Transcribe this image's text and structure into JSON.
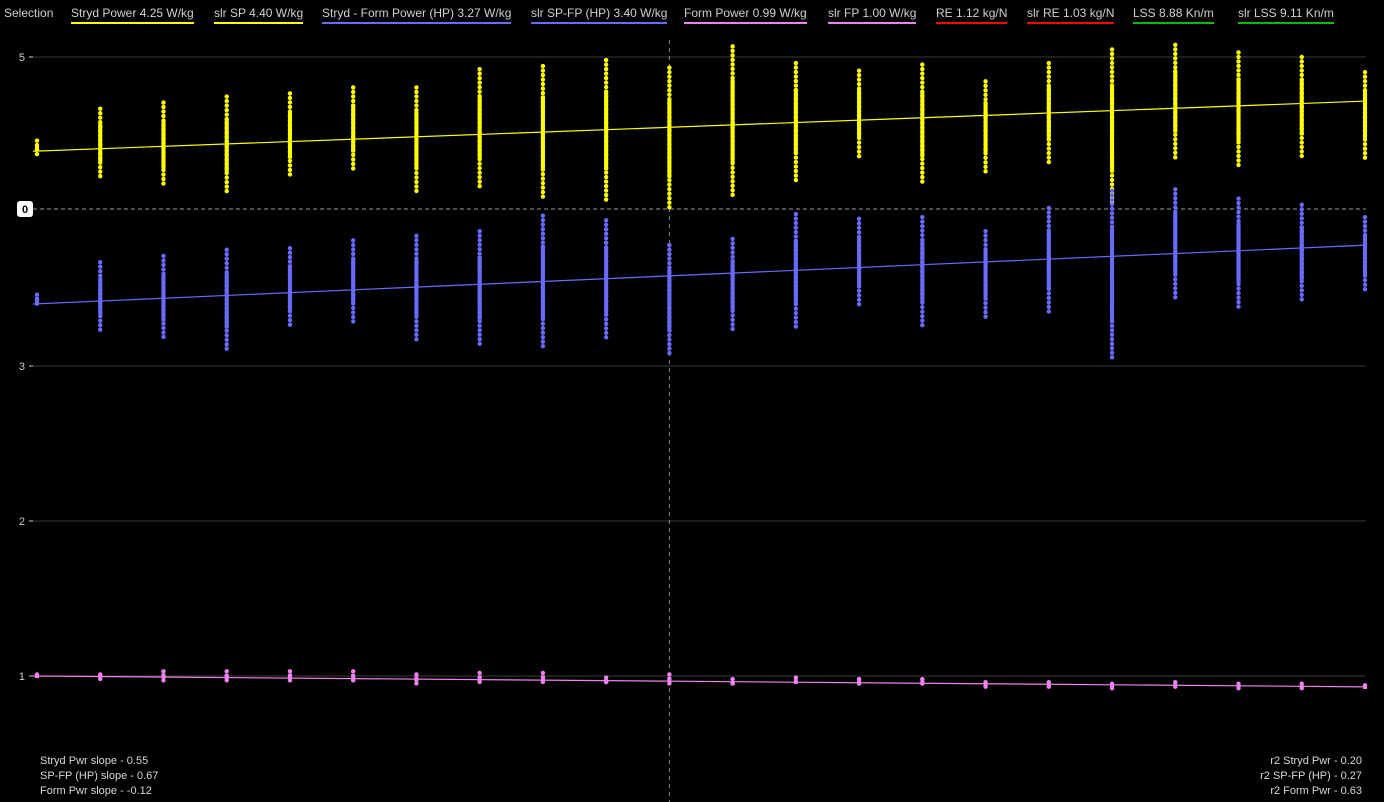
{
  "legend": {
    "title": "Selection",
    "items": [
      {
        "label": "Stryd Power  4.25 W/kg",
        "color": "#ffff00"
      },
      {
        "label": "slr SP  4.40 W/kg",
        "color": "#ffff00"
      },
      {
        "label": "Stryd - Form Power (HP)  3.27 W/kg",
        "color": "#6a6aff"
      },
      {
        "label": "slr SP-FP (HP)  3.40 W/kg",
        "color": "#6a6aff"
      },
      {
        "label": "Form Power  0.99 W/kg",
        "color": "#ee82ee"
      },
      {
        "label": "slr FP  1.00 W/kg",
        "color": "#ee82ee"
      },
      {
        "label": "RE  1.12 kg/N",
        "color": "#ff0000"
      },
      {
        "label": "slr RE  1.03 kg/N",
        "color": "#ff0000"
      },
      {
        "label": "LSS  8.88 Kn/m",
        "color": "#00c000"
      },
      {
        "label": "slr LSS  9.11 Kn/m",
        "color": "#00c000"
      }
    ]
  },
  "stats_left": [
    "Stryd Pwr slope - 0.55",
    "SP-FP (HP) slope - 0.67",
    "Form Pwr slope - -0.12"
  ],
  "stats_right": [
    "r2 Stryd Pwr - 0.20",
    "r2 SP-FP (HP) - 0.27",
    "r2 Form Pwr - 0.63"
  ],
  "chart_data": {
    "type": "scatter",
    "y_axis_ticks": [
      "1",
      "2",
      "3",
      "5"
    ],
    "upper_panel_axis_label": "0",
    "colors": {
      "stryd_power": "#ffff00",
      "sp_fp": "#6a6aff",
      "form_power": "#ee82ee",
      "grid": "#3a3a3a",
      "axis": "#cccccc"
    },
    "series": [
      {
        "name": "Stryd Power",
        "color": "#ffff00",
        "trend": [
          4.38,
          4.71
        ],
        "columns": [
          {
            "min": 4.36,
            "max": 4.45
          },
          {
            "min": 4.21,
            "max": 4.66
          },
          {
            "min": 4.14,
            "max": 4.7
          },
          {
            "min": 4.1,
            "max": 4.74
          },
          {
            "min": 4.21,
            "max": 4.76
          },
          {
            "min": 4.25,
            "max": 4.8
          },
          {
            "min": 4.11,
            "max": 4.8
          },
          {
            "min": 4.15,
            "max": 4.92
          },
          {
            "min": 4.06,
            "max": 4.94
          },
          {
            "min": 4.05,
            "max": 4.98
          },
          {
            "min": 4.0,
            "max": 4.93
          },
          {
            "min": 4.09,
            "max": 5.07
          },
          {
            "min": 4.19,
            "max": 4.96
          },
          {
            "min": 4.34,
            "max": 4.91
          },
          {
            "min": 4.17,
            "max": 4.95
          },
          {
            "min": 4.24,
            "max": 4.84
          },
          {
            "min": 4.3,
            "max": 4.96
          },
          {
            "min": 4.02,
            "max": 5.05
          },
          {
            "min": 4.34,
            "max": 5.08
          },
          {
            "min": 4.28,
            "max": 5.03
          },
          {
            "min": 4.34,
            "max": 5.0
          },
          {
            "min": 4.33,
            "max": 4.9
          }
        ]
      },
      {
        "name": "Stryd - Form Power (HP)",
        "color": "#6a6aff",
        "trend": [
          3.4,
          3.78
        ],
        "columns": [
          {
            "min": 3.39,
            "max": 3.46
          },
          {
            "min": 3.22,
            "max": 3.67
          },
          {
            "min": 3.17,
            "max": 3.71
          },
          {
            "min": 3.1,
            "max": 3.75
          },
          {
            "min": 3.25,
            "max": 3.76
          },
          {
            "min": 3.28,
            "max": 3.81
          },
          {
            "min": 3.17,
            "max": 3.84
          },
          {
            "min": 3.14,
            "max": 3.87
          },
          {
            "min": 3.11,
            "max": 3.97
          },
          {
            "min": 3.16,
            "max": 3.94
          },
          {
            "min": 3.07,
            "max": 3.78
          },
          {
            "min": 3.22,
            "max": 3.82
          },
          {
            "min": 3.24,
            "max": 3.98
          },
          {
            "min": 3.38,
            "max": 3.95
          },
          {
            "min": 3.26,
            "max": 3.96
          },
          {
            "min": 3.3,
            "max": 3.87
          },
          {
            "min": 3.34,
            "max": 4.02
          },
          {
            "min": 3.04,
            "max": 4.13
          },
          {
            "min": 3.44,
            "max": 4.14
          },
          {
            "min": 3.38,
            "max": 4.08
          },
          {
            "min": 3.42,
            "max": 4.04
          },
          {
            "min": 3.48,
            "max": 3.96
          }
        ]
      },
      {
        "name": "Form Power",
        "color": "#ee82ee",
        "trend": [
          1.0,
          0.93
        ],
        "columns": [
          {
            "min": 0.99,
            "max": 1.01
          },
          {
            "min": 0.98,
            "max": 1.01
          },
          {
            "min": 0.97,
            "max": 1.03
          },
          {
            "min": 0.95,
            "max": 1.03
          },
          {
            "min": 0.96,
            "max": 1.03
          },
          {
            "min": 0.95,
            "max": 1.03
          },
          {
            "min": 0.95,
            "max": 1.01
          },
          {
            "min": 0.95,
            "max": 1.02
          },
          {
            "min": 0.95,
            "max": 1.02
          },
          {
            "min": 0.94,
            "max": 0.99
          },
          {
            "min": 0.94,
            "max": 1.01
          },
          {
            "min": 0.93,
            "max": 0.98
          },
          {
            "min": 0.94,
            "max": 0.99
          },
          {
            "min": 0.94,
            "max": 0.98
          },
          {
            "min": 0.94,
            "max": 0.98
          },
          {
            "min": 0.93,
            "max": 0.96
          },
          {
            "min": 0.91,
            "max": 0.96
          },
          {
            "min": 0.92,
            "max": 0.95
          },
          {
            "min": 0.92,
            "max": 0.96
          },
          {
            "min": 0.91,
            "max": 0.95
          },
          {
            "min": 0.91,
            "max": 0.95
          },
          {
            "min": 0.92,
            "max": 0.94
          }
        ]
      }
    ],
    "grid": true,
    "cursor_column": 10
  }
}
